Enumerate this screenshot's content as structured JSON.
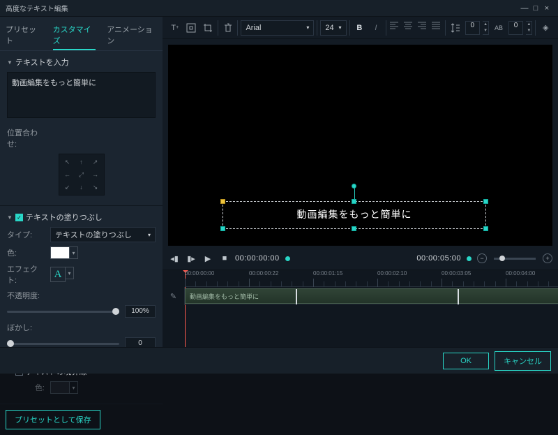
{
  "window": {
    "title": "高度なテキスト編集"
  },
  "tabs": {
    "preset": "プリセット",
    "customize": "カスタマイズ",
    "animation": "アニメーション"
  },
  "textInput": {
    "header": "テキストを入力",
    "value": "動画編集をもっと簡単に"
  },
  "alignment": {
    "label": "位置合わせ:"
  },
  "fill": {
    "header": "テキストの塗りつぶし",
    "type_label": "タイプ:",
    "type_value": "テキストの塗りつぶし",
    "color_label": "色:",
    "color_value": "#ffffff",
    "effect_label": "エフェクト:",
    "effect_value": "A",
    "opacity_label": "不透明度:",
    "opacity_value": "100%",
    "blur_label": "ぼかし:",
    "blur_value": "0"
  },
  "border": {
    "header": "テキストの境界線",
    "color_label": "色:"
  },
  "saveAs": "プリセットとして保存",
  "toolbar": {
    "font": "Arial",
    "size": "24",
    "letterspacing": "0",
    "linespacing": "0"
  },
  "preview": {
    "text": "動画編集をもっと簡単に"
  },
  "transport": {
    "current": "00:00:00:00",
    "end": "00:00:05:00"
  },
  "ruler": {
    "ticks": [
      "00:00:00:00",
      "00:00:00:22",
      "00:00:01:15",
      "00:00:02:10",
      "00:00:03:05",
      "00:00:04:00"
    ]
  },
  "clip": {
    "label": "動画編集をもっと簡単に"
  },
  "footer": {
    "ok": "OK",
    "cancel": "キャンセル"
  }
}
